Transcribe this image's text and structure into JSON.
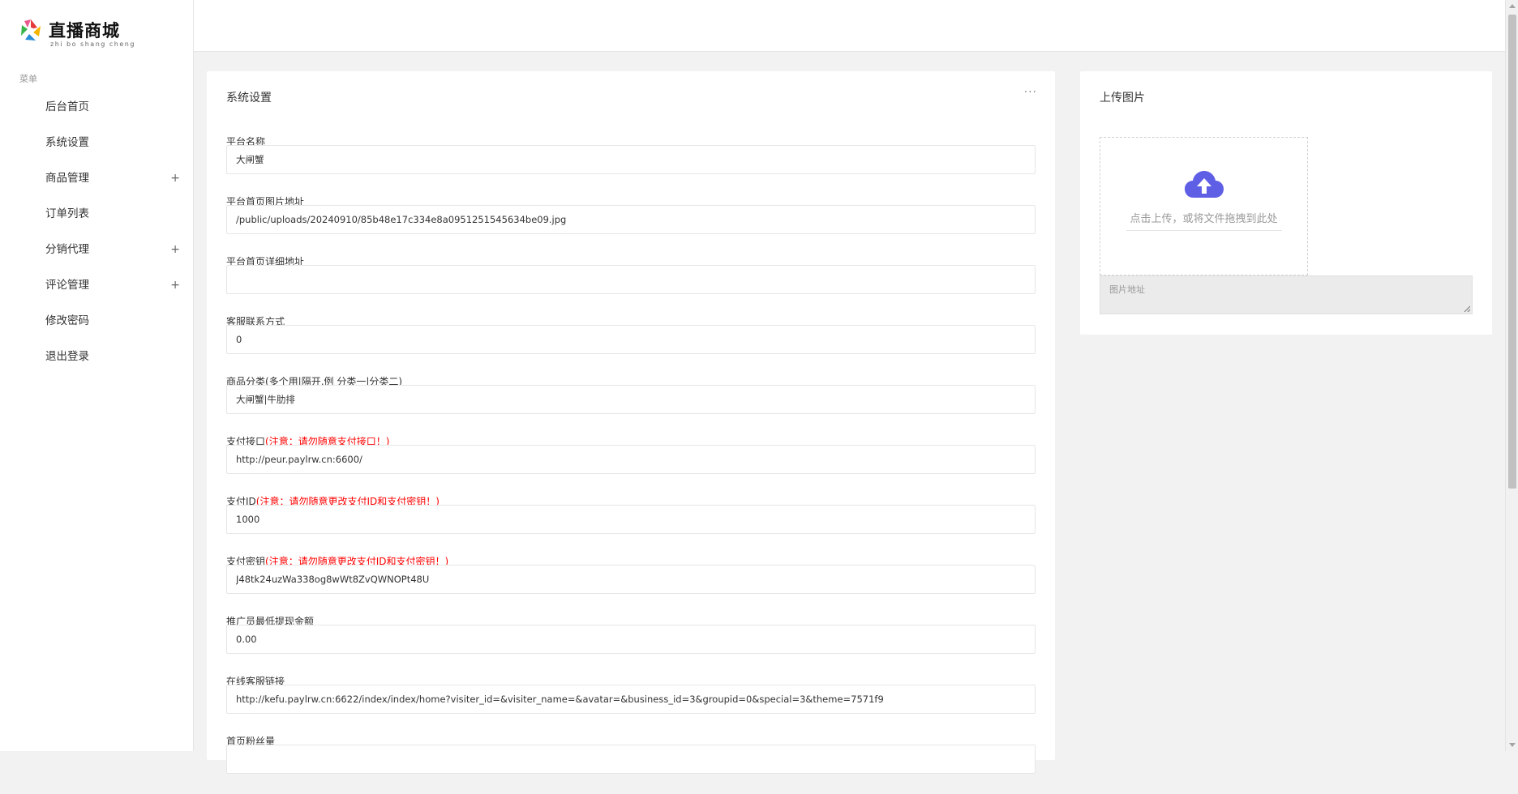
{
  "brand": {
    "title": "直播商城",
    "subtitle": "zhi bo shang cheng"
  },
  "sidebar": {
    "caption": "菜单",
    "items": [
      {
        "label": "后台首页",
        "expand": ""
      },
      {
        "label": "系统设置",
        "expand": ""
      },
      {
        "label": "商品管理",
        "expand": "+"
      },
      {
        "label": "订单列表",
        "expand": ""
      },
      {
        "label": "分销代理",
        "expand": "+"
      },
      {
        "label": "评论管理",
        "expand": "+"
      },
      {
        "label": "修改密码",
        "expand": ""
      },
      {
        "label": "退出登录",
        "expand": ""
      }
    ]
  },
  "settings": {
    "title": "系统设置",
    "more": "···",
    "fields": [
      {
        "label": "平台名称",
        "warn": "",
        "value": "大闸蟹"
      },
      {
        "label": "平台首页图片地址",
        "warn": "",
        "value": "/public/uploads/20240910/85b48e17c334e8a0951251545634be09.jpg"
      },
      {
        "label": "平台首页详细地址",
        "warn": "",
        "value": ""
      },
      {
        "label": "客服联系方式",
        "warn": "",
        "value": "0"
      },
      {
        "label": "商品分类(多个用|隔开,例 分类一|分类二)",
        "warn": "",
        "value": "大闸蟹|牛肋排"
      },
      {
        "label": "支付接口",
        "warn": "(注意：请勿随意支付接口！)",
        "value": "http://peur.paylrw.cn:6600/"
      },
      {
        "label": "支付ID",
        "warn": "(注意：请勿随意更改支付ID和支付密钥！)",
        "value": "1000"
      },
      {
        "label": "支付密钥",
        "warn": "(注意：请勿随意更改支付ID和支付密钥！)",
        "value": "J48tk24uzWa338og8wWt8ZvQWNOPt48U"
      },
      {
        "label": "推广员最低提现金额",
        "warn": "",
        "value": "0.00"
      },
      {
        "label": "在线客服链接",
        "warn": "",
        "value": "http://kefu.paylrw.cn:6622/index/index/home?visiter_id=&visiter_name=&avatar=&business_id=3&groupid=0&special=3&theme=7571f9"
      },
      {
        "label": "首页粉丝量",
        "warn": "",
        "value": ""
      }
    ]
  },
  "upload": {
    "title": "上传图片",
    "drop_text": "点击上传，或将文件拖拽到此处",
    "url_placeholder": "图片地址"
  },
  "colors": {
    "warning": "#ff0000",
    "upload_icon": "#5f5fe6"
  }
}
